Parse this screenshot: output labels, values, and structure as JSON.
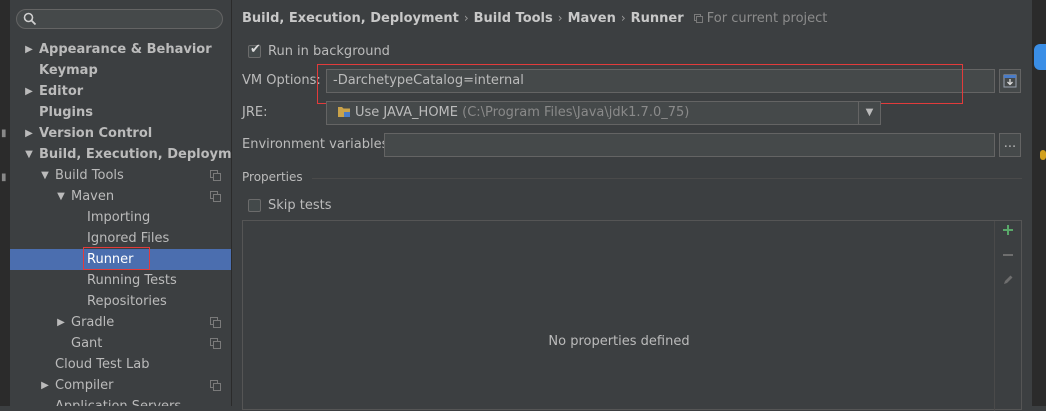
{
  "sidebar": {
    "search_placeholder": "",
    "items": [
      {
        "label": "Appearance & Behavior",
        "expanded": false
      },
      {
        "label": "Keymap"
      },
      {
        "label": "Editor",
        "expanded": false
      },
      {
        "label": "Plugins"
      },
      {
        "label": "Version Control",
        "expanded": false
      },
      {
        "label": "Build, Execution, Deployment",
        "expanded": true
      },
      {
        "label": "Build Tools",
        "expanded": true
      },
      {
        "label": "Maven",
        "expanded": true
      },
      {
        "label": "Importing"
      },
      {
        "label": "Ignored Files"
      },
      {
        "label": "Runner",
        "selected": true
      },
      {
        "label": "Running Tests"
      },
      {
        "label": "Repositories"
      },
      {
        "label": "Gradle",
        "expanded": false
      },
      {
        "label": "Gant"
      },
      {
        "label": "Cloud Test Lab"
      },
      {
        "label": "Compiler",
        "expanded": false
      },
      {
        "label": "Application Servers"
      }
    ]
  },
  "breadcrumb": {
    "items": [
      "Build, Execution, Deployment",
      "Build Tools",
      "Maven",
      "Runner"
    ],
    "separator": "›",
    "scope": "For current project"
  },
  "runner": {
    "run_in_background": {
      "label": "Run in background",
      "checked": true
    },
    "vm_options": {
      "label": "VM Options:",
      "value": "-DarchetypeCatalog=internal"
    },
    "jre": {
      "label": "JRE:",
      "value": "Use JAVA_HOME",
      "path": "(C:\\Program Files\\Java\\jdk1.7.0_75)"
    },
    "env_vars": {
      "label": "Environment variables:",
      "value": "",
      "browse": "..."
    },
    "properties_title": "Properties",
    "skip_tests": {
      "label": "Skip tests",
      "checked": false
    },
    "empty_message": "No properties defined"
  },
  "colors": {
    "background": "#3c3f41",
    "selection": "#4b6eaf",
    "highlight_border": "#e23b3b",
    "add_icon": "#59a869"
  }
}
